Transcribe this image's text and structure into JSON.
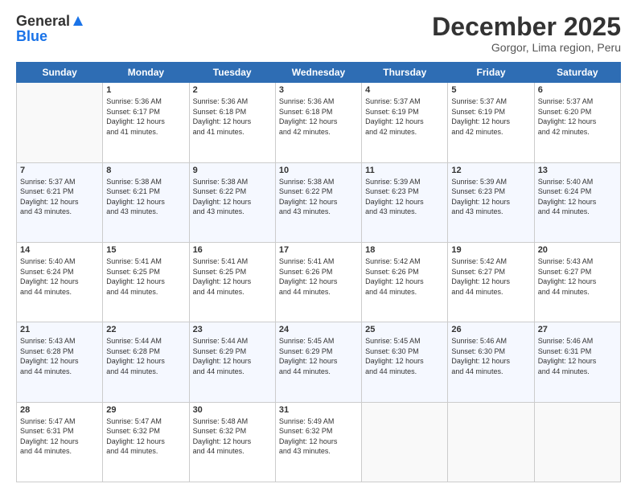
{
  "header": {
    "logo_line1": "General",
    "logo_line2": "Blue",
    "month_title": "December 2025",
    "location": "Gorgor, Lima region, Peru"
  },
  "days_of_week": [
    "Sunday",
    "Monday",
    "Tuesday",
    "Wednesday",
    "Thursday",
    "Friday",
    "Saturday"
  ],
  "weeks": [
    [
      {
        "day": "",
        "info": ""
      },
      {
        "day": "1",
        "info": "Sunrise: 5:36 AM\nSunset: 6:17 PM\nDaylight: 12 hours\nand 41 minutes."
      },
      {
        "day": "2",
        "info": "Sunrise: 5:36 AM\nSunset: 6:18 PM\nDaylight: 12 hours\nand 41 minutes."
      },
      {
        "day": "3",
        "info": "Sunrise: 5:36 AM\nSunset: 6:18 PM\nDaylight: 12 hours\nand 42 minutes."
      },
      {
        "day": "4",
        "info": "Sunrise: 5:37 AM\nSunset: 6:19 PM\nDaylight: 12 hours\nand 42 minutes."
      },
      {
        "day": "5",
        "info": "Sunrise: 5:37 AM\nSunset: 6:19 PM\nDaylight: 12 hours\nand 42 minutes."
      },
      {
        "day": "6",
        "info": "Sunrise: 5:37 AM\nSunset: 6:20 PM\nDaylight: 12 hours\nand 42 minutes."
      }
    ],
    [
      {
        "day": "7",
        "info": "Sunrise: 5:37 AM\nSunset: 6:21 PM\nDaylight: 12 hours\nand 43 minutes."
      },
      {
        "day": "8",
        "info": "Sunrise: 5:38 AM\nSunset: 6:21 PM\nDaylight: 12 hours\nand 43 minutes."
      },
      {
        "day": "9",
        "info": "Sunrise: 5:38 AM\nSunset: 6:22 PM\nDaylight: 12 hours\nand 43 minutes."
      },
      {
        "day": "10",
        "info": "Sunrise: 5:38 AM\nSunset: 6:22 PM\nDaylight: 12 hours\nand 43 minutes."
      },
      {
        "day": "11",
        "info": "Sunrise: 5:39 AM\nSunset: 6:23 PM\nDaylight: 12 hours\nand 43 minutes."
      },
      {
        "day": "12",
        "info": "Sunrise: 5:39 AM\nSunset: 6:23 PM\nDaylight: 12 hours\nand 43 minutes."
      },
      {
        "day": "13",
        "info": "Sunrise: 5:40 AM\nSunset: 6:24 PM\nDaylight: 12 hours\nand 44 minutes."
      }
    ],
    [
      {
        "day": "14",
        "info": "Sunrise: 5:40 AM\nSunset: 6:24 PM\nDaylight: 12 hours\nand 44 minutes."
      },
      {
        "day": "15",
        "info": "Sunrise: 5:41 AM\nSunset: 6:25 PM\nDaylight: 12 hours\nand 44 minutes."
      },
      {
        "day": "16",
        "info": "Sunrise: 5:41 AM\nSunset: 6:25 PM\nDaylight: 12 hours\nand 44 minutes."
      },
      {
        "day": "17",
        "info": "Sunrise: 5:41 AM\nSunset: 6:26 PM\nDaylight: 12 hours\nand 44 minutes."
      },
      {
        "day": "18",
        "info": "Sunrise: 5:42 AM\nSunset: 6:26 PM\nDaylight: 12 hours\nand 44 minutes."
      },
      {
        "day": "19",
        "info": "Sunrise: 5:42 AM\nSunset: 6:27 PM\nDaylight: 12 hours\nand 44 minutes."
      },
      {
        "day": "20",
        "info": "Sunrise: 5:43 AM\nSunset: 6:27 PM\nDaylight: 12 hours\nand 44 minutes."
      }
    ],
    [
      {
        "day": "21",
        "info": "Sunrise: 5:43 AM\nSunset: 6:28 PM\nDaylight: 12 hours\nand 44 minutes."
      },
      {
        "day": "22",
        "info": "Sunrise: 5:44 AM\nSunset: 6:28 PM\nDaylight: 12 hours\nand 44 minutes."
      },
      {
        "day": "23",
        "info": "Sunrise: 5:44 AM\nSunset: 6:29 PM\nDaylight: 12 hours\nand 44 minutes."
      },
      {
        "day": "24",
        "info": "Sunrise: 5:45 AM\nSunset: 6:29 PM\nDaylight: 12 hours\nand 44 minutes."
      },
      {
        "day": "25",
        "info": "Sunrise: 5:45 AM\nSunset: 6:30 PM\nDaylight: 12 hours\nand 44 minutes."
      },
      {
        "day": "26",
        "info": "Sunrise: 5:46 AM\nSunset: 6:30 PM\nDaylight: 12 hours\nand 44 minutes."
      },
      {
        "day": "27",
        "info": "Sunrise: 5:46 AM\nSunset: 6:31 PM\nDaylight: 12 hours\nand 44 minutes."
      }
    ],
    [
      {
        "day": "28",
        "info": "Sunrise: 5:47 AM\nSunset: 6:31 PM\nDaylight: 12 hours\nand 44 minutes."
      },
      {
        "day": "29",
        "info": "Sunrise: 5:47 AM\nSunset: 6:32 PM\nDaylight: 12 hours\nand 44 minutes."
      },
      {
        "day": "30",
        "info": "Sunrise: 5:48 AM\nSunset: 6:32 PM\nDaylight: 12 hours\nand 44 minutes."
      },
      {
        "day": "31",
        "info": "Sunrise: 5:49 AM\nSunset: 6:32 PM\nDaylight: 12 hours\nand 43 minutes."
      },
      {
        "day": "",
        "info": ""
      },
      {
        "day": "",
        "info": ""
      },
      {
        "day": "",
        "info": ""
      }
    ]
  ]
}
